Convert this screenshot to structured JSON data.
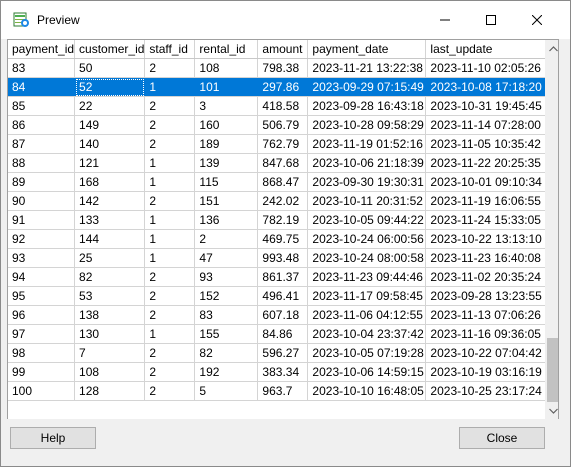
{
  "window": {
    "title": "Preview",
    "icon": "preview-app-icon",
    "controls": [
      "minimize-icon",
      "maximize-icon",
      "close-icon"
    ]
  },
  "grid": {
    "columns": [
      "payment_id",
      "customer_id",
      "staff_id",
      "rental_id",
      "amount",
      "payment_date",
      "last_update"
    ],
    "selected_row_index": 1,
    "rows": [
      [
        "83",
        "50",
        "2",
        "108",
        "798.38",
        "2023-11-21 13:22:38",
        "2023-11-10 02:05:26"
      ],
      [
        "84",
        "52",
        "1",
        "101",
        "297.86",
        "2023-09-29 07:15:49",
        "2023-10-08 17:18:20"
      ],
      [
        "85",
        "22",
        "2",
        "3",
        "418.58",
        "2023-09-28 16:43:18",
        "2023-10-31 19:45:45"
      ],
      [
        "86",
        "149",
        "2",
        "160",
        "506.79",
        "2023-10-28 09:58:29",
        "2023-11-14 07:28:00"
      ],
      [
        "87",
        "140",
        "2",
        "189",
        "762.79",
        "2023-11-19 01:52:16",
        "2023-11-05 10:35:42"
      ],
      [
        "88",
        "121",
        "1",
        "139",
        "847.68",
        "2023-10-06 21:18:39",
        "2023-11-22 20:25:35"
      ],
      [
        "89",
        "168",
        "1",
        "115",
        "868.47",
        "2023-09-30 19:30:31",
        "2023-10-01 09:10:34"
      ],
      [
        "90",
        "142",
        "2",
        "151",
        "242.02",
        "2023-10-11 20:31:52",
        "2023-11-19 16:06:55"
      ],
      [
        "91",
        "133",
        "1",
        "136",
        "782.19",
        "2023-10-05 09:44:22",
        "2023-11-24 15:33:05"
      ],
      [
        "92",
        "144",
        "1",
        "2",
        "469.75",
        "2023-10-24 06:00:56",
        "2023-10-22 13:13:10"
      ],
      [
        "93",
        "25",
        "1",
        "47",
        "993.48",
        "2023-10-24 08:00:58",
        "2023-11-23 16:40:08"
      ],
      [
        "94",
        "82",
        "2",
        "93",
        "861.37",
        "2023-11-23 09:44:46",
        "2023-11-02 20:35:24"
      ],
      [
        "95",
        "53",
        "2",
        "152",
        "496.41",
        "2023-11-17 09:58:45",
        "2023-09-28 13:23:55"
      ],
      [
        "96",
        "138",
        "2",
        "83",
        "607.18",
        "2023-11-06 04:12:55",
        "2023-11-13 07:06:26"
      ],
      [
        "97",
        "130",
        "1",
        "155",
        "84.86",
        "2023-10-04 23:37:42",
        "2023-11-16 09:36:05"
      ],
      [
        "98",
        "7",
        "2",
        "82",
        "596.27",
        "2023-10-05 07:19:28",
        "2023-10-22 07:04:42"
      ],
      [
        "99",
        "108",
        "2",
        "192",
        "383.34",
        "2023-10-06 14:59:15",
        "2023-10-19 03:16:19"
      ],
      [
        "100",
        "128",
        "2",
        "5",
        "963.7",
        "2023-10-10 16:48:05",
        "2023-10-25 23:17:24"
      ]
    ]
  },
  "footer": {
    "help_label": "Help",
    "close_label": "Close"
  },
  "colors": {
    "selection": "#0078d7",
    "grid_line": "#d4d4d4",
    "window_bg": "#f0f0f0"
  }
}
